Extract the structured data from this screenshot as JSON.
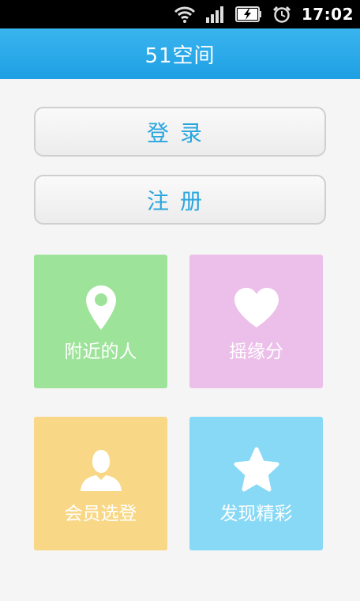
{
  "status_bar": {
    "time": "17:02",
    "icons": [
      "wifi-icon",
      "signal-icon",
      "battery-charging-icon",
      "alarm-clock-icon"
    ]
  },
  "app_bar": {
    "title": "51空间"
  },
  "buttons": {
    "login": "登录",
    "register": "注册"
  },
  "tiles": [
    {
      "id": "nearby",
      "label": "附近的人",
      "icon": "location-pin-icon",
      "color": "#9ee39a"
    },
    {
      "id": "shake",
      "label": "摇缘分",
      "icon": "heart-icon",
      "color": "#ebbfe9"
    },
    {
      "id": "member",
      "label": "会员选登",
      "icon": "user-silhouette-icon",
      "color": "#f8d886"
    },
    {
      "id": "discover",
      "label": "发现精彩",
      "icon": "star-icon",
      "color": "#88d9f6"
    }
  ],
  "colors": {
    "accent": "#29a6de",
    "app_bar": "#1fa0e4"
  }
}
